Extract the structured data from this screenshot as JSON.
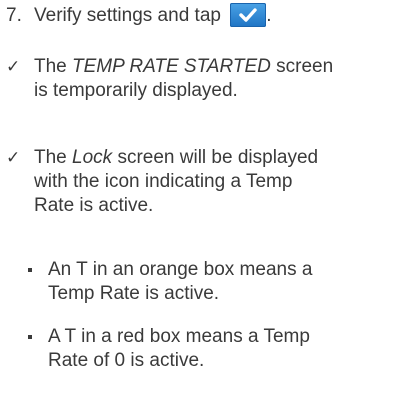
{
  "step": {
    "number": "7.",
    "text_before": "Verify settings and tap",
    "text_after": ".",
    "button_icon": "checkmark-icon",
    "button_color": "#2f86d6"
  },
  "results": [
    {
      "marker": "✓",
      "prefix": "The ",
      "emphasis": "TEMP RATE STARTED",
      "suffix_line1": " screen",
      "line2": "is temporarily displayed."
    },
    {
      "marker": "✓",
      "prefix": "The ",
      "emphasis": "Lock",
      "suffix_line1": " screen will be displayed",
      "line2": "with the icon indicating a Temp",
      "line3": "Rate is active."
    }
  ],
  "bullets": [
    {
      "line1": "An T in an orange box means a",
      "line2": "Temp Rate is active."
    },
    {
      "line1": "A T in a red box means a Temp",
      "line2": "Rate of 0 is active."
    }
  ]
}
